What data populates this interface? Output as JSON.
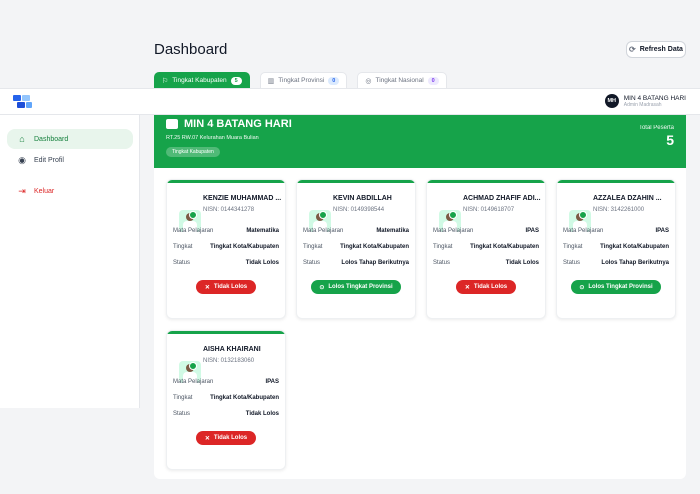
{
  "header": {
    "title": "Dashboard",
    "refresh_label": "Refresh Data"
  },
  "tabs": [
    {
      "label": "Tingkat Kabupaten",
      "count": "5",
      "icon": "flag-icon"
    },
    {
      "label": "Tingkat Provinsi",
      "count": "0",
      "icon": "building-icon"
    },
    {
      "label": "Tingkat Nasional",
      "count": "0",
      "icon": "globe-icon"
    }
  ],
  "user": {
    "initials": "MH",
    "name": "MIN 4 BATANG HARI",
    "role": "Admin Madrasah"
  },
  "sidebar": {
    "items": [
      {
        "label": "Dashboard",
        "icon": "home-icon"
      },
      {
        "label": "Edit Profil",
        "icon": "user-icon"
      },
      {
        "label": "Keluar",
        "icon": "logout-icon"
      }
    ]
  },
  "school": {
    "name": "MIN 4 BATANG HARI",
    "address": "RT.25 RW.07 Kelurahan Muara Bulian",
    "level_pill": "Tingkat Kabupaten",
    "total_label": "Total Peserta",
    "total_value": "5"
  },
  "row_labels": {
    "subject": "Mata Pelajaran",
    "level": "Tingkat",
    "status": "Status"
  },
  "students": [
    {
      "name": "KENZIE MUHAMMAD ...",
      "nisn": "NISN: 0144341278",
      "subject": "Matematika",
      "level": "Tingkat Kota/Kabupaten",
      "status": "Tidak Lolos",
      "result": "Tidak Lolos",
      "result_type": "red"
    },
    {
      "name": "KEVIN ABDILLAH",
      "nisn": "NISN: 0149398544",
      "subject": "Matematika",
      "level": "Tingkat Kota/Kabupaten",
      "status": "Lolos Tahap Berikutnya",
      "result": "Lolos Tingkat Provinsi",
      "result_type": "green"
    },
    {
      "name": "ACHMAD ZHAFIF ADI...",
      "nisn": "NISN: 0149618707",
      "subject": "IPAS",
      "level": "Tingkat Kota/Kabupaten",
      "status": "Tidak Lolos",
      "result": "Tidak Lolos",
      "result_type": "red"
    },
    {
      "name": "AZZALEA DZAHIN ...",
      "nisn": "NISN: 3142261000",
      "subject": "IPAS",
      "level": "Tingkat Kota/Kabupaten",
      "status": "Lolos Tahap Berikutnya",
      "result": "Lolos Tingkat Provinsi",
      "result_type": "green"
    },
    {
      "name": "AISHA KHAIRANI",
      "nisn": "NISN: 0132183060",
      "subject": "IPAS",
      "level": "Tingkat Kota/Kabupaten",
      "status": "Tidak Lolos",
      "result": "Tidak Lolos",
      "result_type": "red"
    }
  ],
  "colors": {
    "primary": "#16a34a",
    "danger": "#dc2626"
  }
}
